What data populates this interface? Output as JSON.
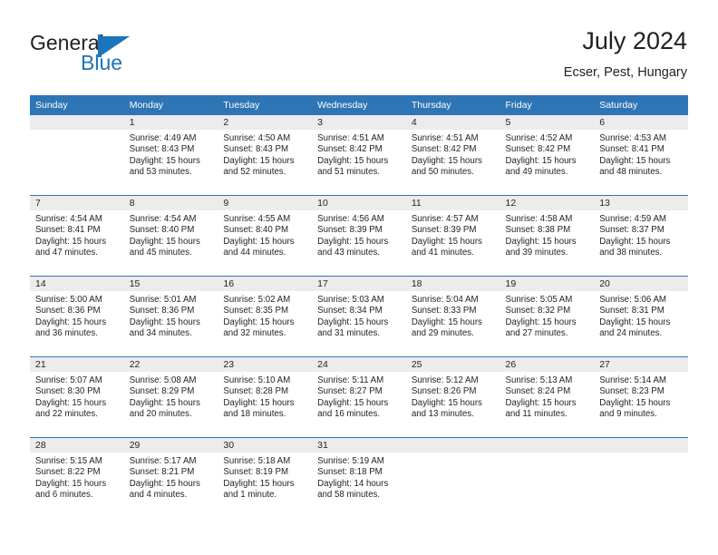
{
  "brand": {
    "name_top": "General",
    "name_bottom": "Blue",
    "accent_color": "#1b75bb"
  },
  "header": {
    "title": "July 2024",
    "subtitle": "Ecser, Pest, Hungary"
  },
  "calendar": {
    "header_bg": "#2e75b6",
    "daynum_bg": "#ececec",
    "weekday_headers": [
      "Sunday",
      "Monday",
      "Tuesday",
      "Wednesday",
      "Thursday",
      "Friday",
      "Saturday"
    ],
    "weeks": [
      [
        {
          "day": "",
          "sunrise": "",
          "sunset": "",
          "daylight_1": "",
          "daylight_2": ""
        },
        {
          "day": "1",
          "sunrise": "Sunrise: 4:49 AM",
          "sunset": "Sunset: 8:43 PM",
          "daylight_1": "Daylight: 15 hours",
          "daylight_2": "and 53 minutes."
        },
        {
          "day": "2",
          "sunrise": "Sunrise: 4:50 AM",
          "sunset": "Sunset: 8:43 PM",
          "daylight_1": "Daylight: 15 hours",
          "daylight_2": "and 52 minutes."
        },
        {
          "day": "3",
          "sunrise": "Sunrise: 4:51 AM",
          "sunset": "Sunset: 8:42 PM",
          "daylight_1": "Daylight: 15 hours",
          "daylight_2": "and 51 minutes."
        },
        {
          "day": "4",
          "sunrise": "Sunrise: 4:51 AM",
          "sunset": "Sunset: 8:42 PM",
          "daylight_1": "Daylight: 15 hours",
          "daylight_2": "and 50 minutes."
        },
        {
          "day": "5",
          "sunrise": "Sunrise: 4:52 AM",
          "sunset": "Sunset: 8:42 PM",
          "daylight_1": "Daylight: 15 hours",
          "daylight_2": "and 49 minutes."
        },
        {
          "day": "6",
          "sunrise": "Sunrise: 4:53 AM",
          "sunset": "Sunset: 8:41 PM",
          "daylight_1": "Daylight: 15 hours",
          "daylight_2": "and 48 minutes."
        }
      ],
      [
        {
          "day": "7",
          "sunrise": "Sunrise: 4:54 AM",
          "sunset": "Sunset: 8:41 PM",
          "daylight_1": "Daylight: 15 hours",
          "daylight_2": "and 47 minutes."
        },
        {
          "day": "8",
          "sunrise": "Sunrise: 4:54 AM",
          "sunset": "Sunset: 8:40 PM",
          "daylight_1": "Daylight: 15 hours",
          "daylight_2": "and 45 minutes."
        },
        {
          "day": "9",
          "sunrise": "Sunrise: 4:55 AM",
          "sunset": "Sunset: 8:40 PM",
          "daylight_1": "Daylight: 15 hours",
          "daylight_2": "and 44 minutes."
        },
        {
          "day": "10",
          "sunrise": "Sunrise: 4:56 AM",
          "sunset": "Sunset: 8:39 PM",
          "daylight_1": "Daylight: 15 hours",
          "daylight_2": "and 43 minutes."
        },
        {
          "day": "11",
          "sunrise": "Sunrise: 4:57 AM",
          "sunset": "Sunset: 8:39 PM",
          "daylight_1": "Daylight: 15 hours",
          "daylight_2": "and 41 minutes."
        },
        {
          "day": "12",
          "sunrise": "Sunrise: 4:58 AM",
          "sunset": "Sunset: 8:38 PM",
          "daylight_1": "Daylight: 15 hours",
          "daylight_2": "and 39 minutes."
        },
        {
          "day": "13",
          "sunrise": "Sunrise: 4:59 AM",
          "sunset": "Sunset: 8:37 PM",
          "daylight_1": "Daylight: 15 hours",
          "daylight_2": "and 38 minutes."
        }
      ],
      [
        {
          "day": "14",
          "sunrise": "Sunrise: 5:00 AM",
          "sunset": "Sunset: 8:36 PM",
          "daylight_1": "Daylight: 15 hours",
          "daylight_2": "and 36 minutes."
        },
        {
          "day": "15",
          "sunrise": "Sunrise: 5:01 AM",
          "sunset": "Sunset: 8:36 PM",
          "daylight_1": "Daylight: 15 hours",
          "daylight_2": "and 34 minutes."
        },
        {
          "day": "16",
          "sunrise": "Sunrise: 5:02 AM",
          "sunset": "Sunset: 8:35 PM",
          "daylight_1": "Daylight: 15 hours",
          "daylight_2": "and 32 minutes."
        },
        {
          "day": "17",
          "sunrise": "Sunrise: 5:03 AM",
          "sunset": "Sunset: 8:34 PM",
          "daylight_1": "Daylight: 15 hours",
          "daylight_2": "and 31 minutes."
        },
        {
          "day": "18",
          "sunrise": "Sunrise: 5:04 AM",
          "sunset": "Sunset: 8:33 PM",
          "daylight_1": "Daylight: 15 hours",
          "daylight_2": "and 29 minutes."
        },
        {
          "day": "19",
          "sunrise": "Sunrise: 5:05 AM",
          "sunset": "Sunset: 8:32 PM",
          "daylight_1": "Daylight: 15 hours",
          "daylight_2": "and 27 minutes."
        },
        {
          "day": "20",
          "sunrise": "Sunrise: 5:06 AM",
          "sunset": "Sunset: 8:31 PM",
          "daylight_1": "Daylight: 15 hours",
          "daylight_2": "and 24 minutes."
        }
      ],
      [
        {
          "day": "21",
          "sunrise": "Sunrise: 5:07 AM",
          "sunset": "Sunset: 8:30 PM",
          "daylight_1": "Daylight: 15 hours",
          "daylight_2": "and 22 minutes."
        },
        {
          "day": "22",
          "sunrise": "Sunrise: 5:08 AM",
          "sunset": "Sunset: 8:29 PM",
          "daylight_1": "Daylight: 15 hours",
          "daylight_2": "and 20 minutes."
        },
        {
          "day": "23",
          "sunrise": "Sunrise: 5:10 AM",
          "sunset": "Sunset: 8:28 PM",
          "daylight_1": "Daylight: 15 hours",
          "daylight_2": "and 18 minutes."
        },
        {
          "day": "24",
          "sunrise": "Sunrise: 5:11 AM",
          "sunset": "Sunset: 8:27 PM",
          "daylight_1": "Daylight: 15 hours",
          "daylight_2": "and 16 minutes."
        },
        {
          "day": "25",
          "sunrise": "Sunrise: 5:12 AM",
          "sunset": "Sunset: 8:26 PM",
          "daylight_1": "Daylight: 15 hours",
          "daylight_2": "and 13 minutes."
        },
        {
          "day": "26",
          "sunrise": "Sunrise: 5:13 AM",
          "sunset": "Sunset: 8:24 PM",
          "daylight_1": "Daylight: 15 hours",
          "daylight_2": "and 11 minutes."
        },
        {
          "day": "27",
          "sunrise": "Sunrise: 5:14 AM",
          "sunset": "Sunset: 8:23 PM",
          "daylight_1": "Daylight: 15 hours",
          "daylight_2": "and 9 minutes."
        }
      ],
      [
        {
          "day": "28",
          "sunrise": "Sunrise: 5:15 AM",
          "sunset": "Sunset: 8:22 PM",
          "daylight_1": "Daylight: 15 hours",
          "daylight_2": "and 6 minutes."
        },
        {
          "day": "29",
          "sunrise": "Sunrise: 5:17 AM",
          "sunset": "Sunset: 8:21 PM",
          "daylight_1": "Daylight: 15 hours",
          "daylight_2": "and 4 minutes."
        },
        {
          "day": "30",
          "sunrise": "Sunrise: 5:18 AM",
          "sunset": "Sunset: 8:19 PM",
          "daylight_1": "Daylight: 15 hours",
          "daylight_2": "and 1 minute."
        },
        {
          "day": "31",
          "sunrise": "Sunrise: 5:19 AM",
          "sunset": "Sunset: 8:18 PM",
          "daylight_1": "Daylight: 14 hours",
          "daylight_2": "and 58 minutes."
        },
        {
          "day": "",
          "sunrise": "",
          "sunset": "",
          "daylight_1": "",
          "daylight_2": ""
        },
        {
          "day": "",
          "sunrise": "",
          "sunset": "",
          "daylight_1": "",
          "daylight_2": ""
        },
        {
          "day": "",
          "sunrise": "",
          "sunset": "",
          "daylight_1": "",
          "daylight_2": ""
        }
      ]
    ]
  }
}
